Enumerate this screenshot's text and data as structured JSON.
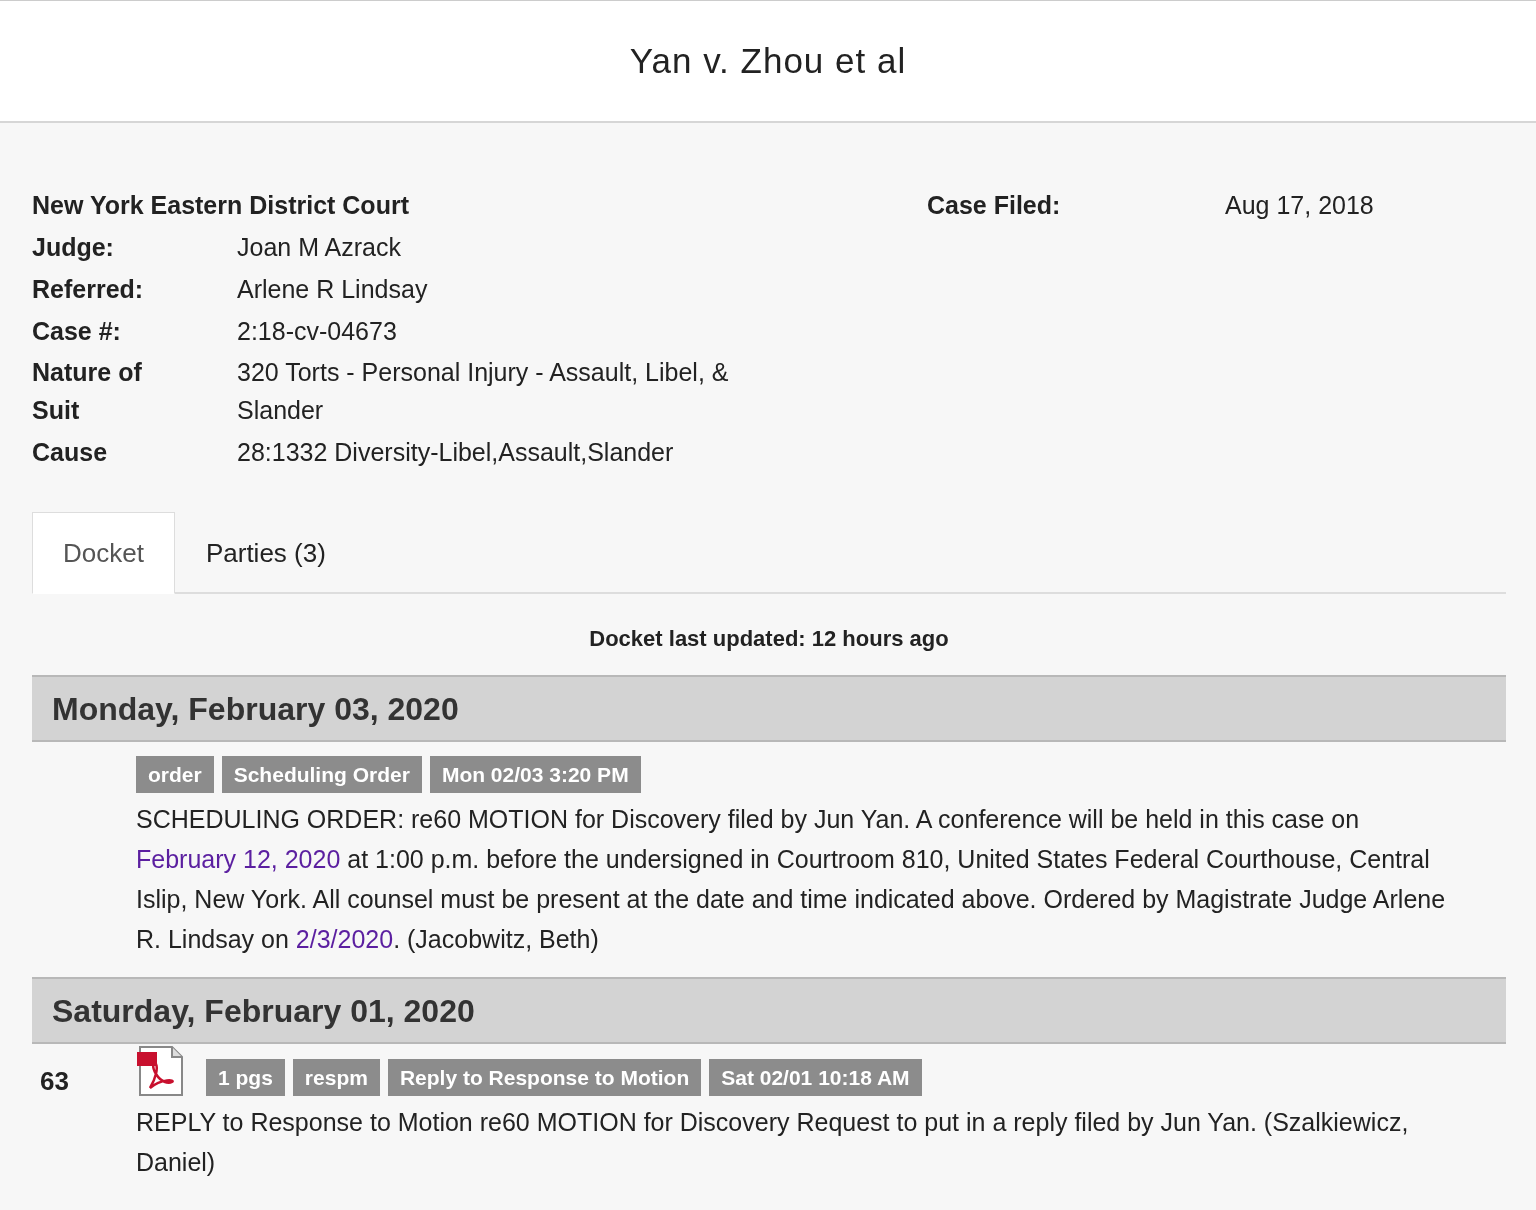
{
  "title": "Yan v. Zhou et al",
  "court": "New York Eastern District Court",
  "case_filed": {
    "label": "Case Filed:",
    "value": "Aug 17, 2018"
  },
  "fields": [
    {
      "label": "Judge:",
      "value": "Joan M Azrack"
    },
    {
      "label": "Referred:",
      "value": "Arlene R Lindsay"
    },
    {
      "label": "Case #:",
      "value": "2:18-cv-04673"
    },
    {
      "label": "Nature of Suit",
      "value": "320 Torts - Personal Injury - Assault, Libel, & Slander"
    },
    {
      "label": "Cause",
      "value": "28:1332 Diversity-Libel,Assault,Slander"
    }
  ],
  "tabs": [
    {
      "label": "Docket",
      "selected": true
    },
    {
      "label": "Parties (3)",
      "selected": false
    }
  ],
  "last_updated": "Docket last updated: 12 hours ago",
  "days": [
    {
      "date": "Monday, February 03, 2020",
      "entries": [
        {
          "document": false,
          "tags": [
            "order",
            "Scheduling Order",
            "Mon 02/03 3:20 PM"
          ],
          "description": [
            {
              "kind": "text",
              "text": "SCHEDULING ORDER: re60 MOTION for Discovery filed by Jun Yan. A conference will be held in this case on "
            },
            {
              "kind": "link",
              "text": "February 12, 2020"
            },
            {
              "kind": "text",
              "text": " at 1:00 p.m. before the undersigned in Courtroom 810, United States Federal Courthouse, Central Islip, New York. All counsel must be present at the date and time indicated above. Ordered by Magistrate Judge Arlene R. Lindsay on "
            },
            {
              "kind": "link",
              "text": "2/3/2020"
            },
            {
              "kind": "text",
              "text": ". (Jacobwitz, Beth)"
            }
          ]
        }
      ]
    },
    {
      "date": "Saturday, February 01, 2020",
      "entries": [
        {
          "number": "63",
          "document": true,
          "tags": [
            "1 pgs",
            "respm",
            "Reply to Response to Motion",
            "Sat 02/01 10:18 AM"
          ],
          "description": [
            {
              "kind": "text",
              "text": "REPLY to Response to Motion re60 MOTION for Discovery Request to put in a reply filed by Jun Yan. (Szalkiewicz, Daniel)"
            }
          ]
        }
      ]
    }
  ]
}
